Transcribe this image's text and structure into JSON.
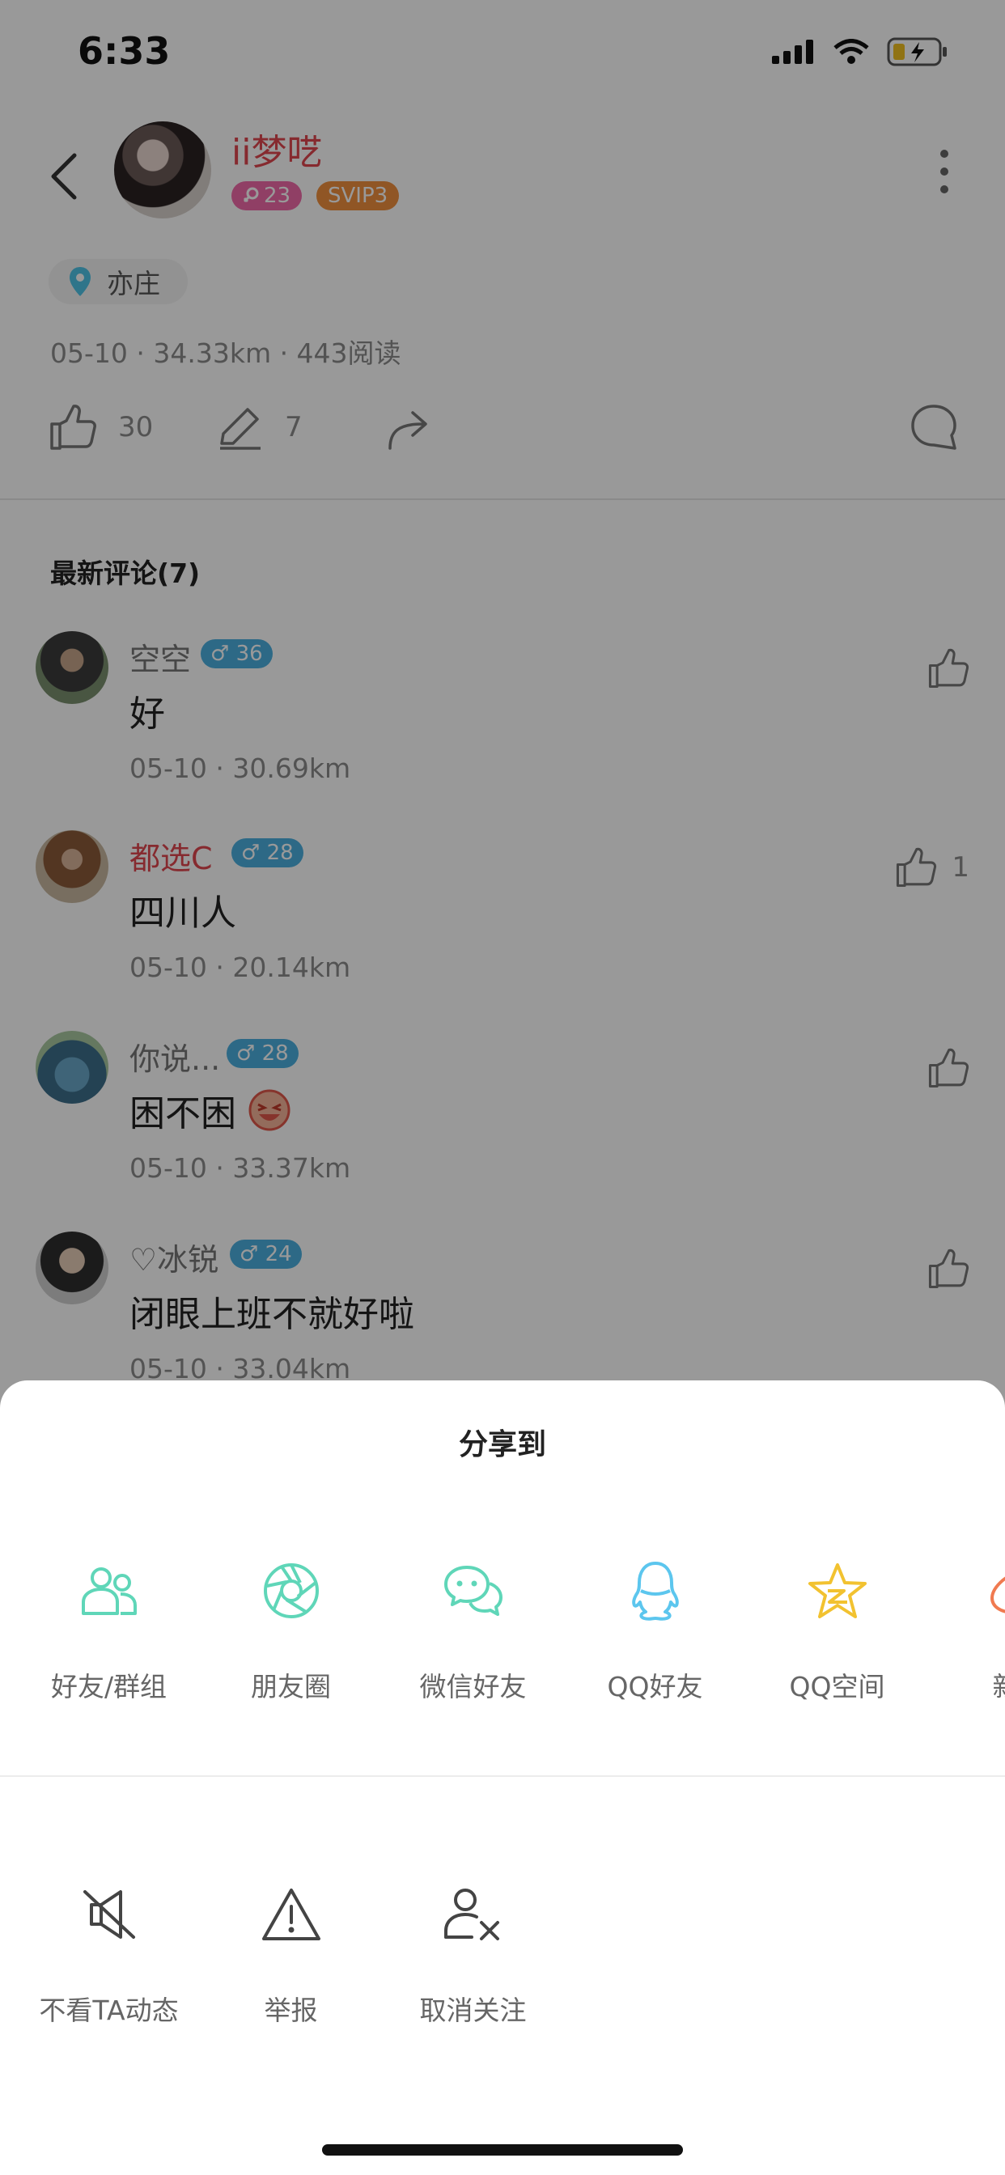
{
  "status": {
    "time": "6:33"
  },
  "header": {
    "username": "ii梦呓",
    "level_badge": "23",
    "svip_badge": "SVIP3"
  },
  "post": {
    "location": "亦庄",
    "meta": "05-10 · 34.33km · 443阅读",
    "likes": "30",
    "comments_count": "7"
  },
  "comments": {
    "title": "最新评论(7)",
    "items": [
      {
        "name": "空空",
        "badge": "♂ 36",
        "text": "好",
        "meta": "05-10 · 30.69km",
        "likes": ""
      },
      {
        "name": "都选C",
        "badge": "♂ 28",
        "text": "四川人",
        "meta": "05-10 · 20.14km",
        "likes": "1"
      },
      {
        "name": "你说...",
        "badge": "♂ 28",
        "text": "困不困",
        "meta": "05-10 · 33.37km",
        "likes": ""
      },
      {
        "name": "♡冰锐",
        "badge": "♂ 24",
        "text": "闭眼上班不就好啦",
        "meta": "05-10 · 33.04km",
        "likes": ""
      }
    ]
  },
  "share_sheet": {
    "title": "分享到",
    "targets": [
      {
        "label": "好友/群组",
        "icon": "friends-group-icon",
        "color": "#5fd6b8"
      },
      {
        "label": "朋友圈",
        "icon": "moments-icon",
        "color": "#5fd6b8"
      },
      {
        "label": "微信好友",
        "icon": "wechat-icon",
        "color": "#5fd6b8"
      },
      {
        "label": "QQ好友",
        "icon": "qq-icon",
        "color": "#5cc6ee"
      },
      {
        "label": "QQ空间",
        "icon": "qzone-icon",
        "color": "#f2c230"
      },
      {
        "label": "新浪",
        "icon": "weibo-icon",
        "color": "#f07a50"
      }
    ],
    "options": [
      {
        "label": "不看TA动态",
        "icon": "hide-feed-icon"
      },
      {
        "label": "举报",
        "icon": "report-warning-icon"
      },
      {
        "label": "取消关注",
        "icon": "unfollow-icon"
      }
    ]
  }
}
